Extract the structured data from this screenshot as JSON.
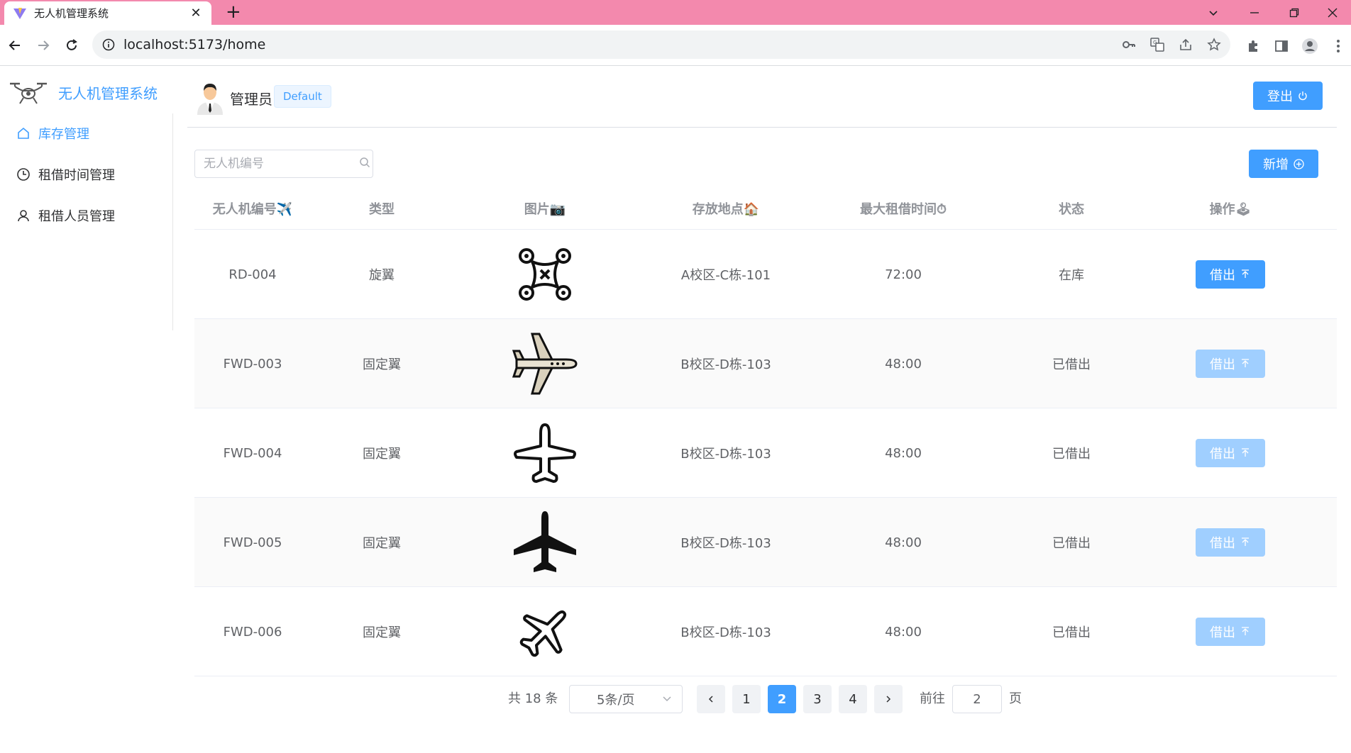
{
  "browser": {
    "tab_title": "无人机管理系统",
    "url": "localhost:5173/home"
  },
  "brand": {
    "title": "无人机管理系统"
  },
  "sidebar": {
    "items": [
      {
        "label": "库存管理",
        "icon": "home-icon",
        "active": true
      },
      {
        "label": "租借时间管理",
        "icon": "clock-icon",
        "active": false
      },
      {
        "label": "租借人员管理",
        "icon": "user-icon",
        "active": false
      }
    ]
  },
  "header": {
    "user_name": "管理员",
    "user_tag": "Default",
    "logout_label": "登出"
  },
  "toolbar": {
    "search_placeholder": "无人机编号",
    "add_label": "新增"
  },
  "table": {
    "columns": [
      "无人机编号✈️",
      "类型",
      "图片📷",
      "存放地点🏠",
      "最大租借时间⏱",
      "状态",
      "操作🕹"
    ],
    "rows": [
      {
        "id": "RD-004",
        "type": "旋翼",
        "image": "quadcopter-icon",
        "location": "A校区-C栋-101",
        "max_time": "72:00",
        "status": "在库",
        "action": "借出",
        "enabled": true
      },
      {
        "id": "FWD-003",
        "type": "固定翼",
        "image": "airliner-side-icon",
        "location": "B校区-D栋-103",
        "max_time": "48:00",
        "status": "已借出",
        "action": "借出",
        "enabled": false
      },
      {
        "id": "FWD-004",
        "type": "固定翼",
        "image": "plane-outline-icon",
        "location": "B校区-D栋-103",
        "max_time": "48:00",
        "status": "已借出",
        "action": "借出",
        "enabled": false
      },
      {
        "id": "FWD-005",
        "type": "固定翼",
        "image": "plane-solid-icon",
        "location": "B校区-D栋-103",
        "max_time": "48:00",
        "status": "已借出",
        "action": "借出",
        "enabled": false
      },
      {
        "id": "FWD-006",
        "type": "固定翼",
        "image": "plane-tilted-icon",
        "location": "B校区-D栋-103",
        "max_time": "48:00",
        "status": "已借出",
        "action": "借出",
        "enabled": false
      }
    ]
  },
  "pagination": {
    "total_text": "共 18 条",
    "page_size": "5条/页",
    "pages": [
      "1",
      "2",
      "3",
      "4"
    ],
    "current": "2",
    "goto_label": "前往",
    "goto_value": "2",
    "page_suffix": "页"
  },
  "colors": {
    "accent": "#409eff",
    "accent_disabled": "#a0cfff",
    "tabbar": "#f389ad"
  }
}
